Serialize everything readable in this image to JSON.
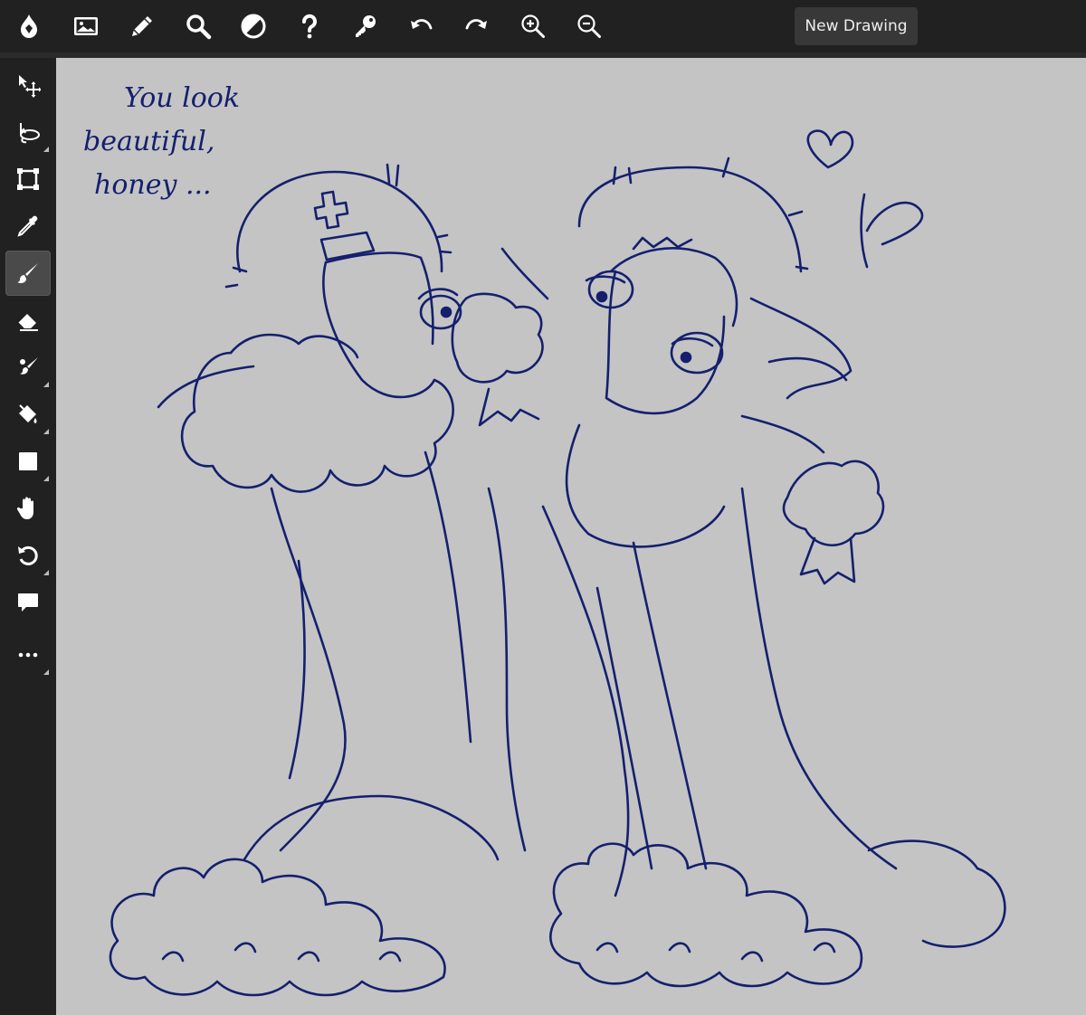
{
  "toolbar": {
    "new_drawing_label": "New Drawing",
    "buttons": [
      {
        "name": "app-logo-icon",
        "icon": "drop-logo"
      },
      {
        "name": "image-icon",
        "icon": "image"
      },
      {
        "name": "pencil-icon",
        "icon": "pencil"
      },
      {
        "name": "search-icon",
        "icon": "magnifier"
      },
      {
        "name": "contrast-icon",
        "icon": "half-circle"
      },
      {
        "name": "help-icon",
        "icon": "question-mark"
      },
      {
        "name": "key-icon",
        "icon": "key"
      },
      {
        "name": "undo-icon",
        "icon": "undo-arrow"
      },
      {
        "name": "redo-icon",
        "icon": "redo-arrow"
      },
      {
        "name": "zoom-in-icon",
        "icon": "magnifier-plus"
      },
      {
        "name": "zoom-out-icon",
        "icon": "magnifier-minus"
      }
    ]
  },
  "sidebar": {
    "tools": [
      {
        "name": "move-tool",
        "icon": "arrow-move"
      },
      {
        "name": "lasso-tool",
        "icon": "lasso"
      },
      {
        "name": "transform-tool",
        "icon": "bounding-box"
      },
      {
        "name": "eyedropper-tool",
        "icon": "eyedropper"
      },
      {
        "name": "brush-tool",
        "icon": "brush",
        "active": true
      },
      {
        "name": "eraser-tool",
        "icon": "eraser"
      },
      {
        "name": "smudge-tool",
        "icon": "brushes"
      },
      {
        "name": "fill-tool",
        "icon": "paint-bucket"
      },
      {
        "name": "shape-tool",
        "icon": "square"
      },
      {
        "name": "hand-tool",
        "icon": "hand"
      },
      {
        "name": "rotate-tool",
        "icon": "rotate-ccw"
      },
      {
        "name": "text-tool",
        "icon": "speech-bubble"
      },
      {
        "name": "more-tools",
        "icon": "ellipsis"
      }
    ]
  },
  "canvas": {
    "background_color": "#c4c4c4",
    "stroke_color": "#14206e",
    "handwriting": [
      "You look",
      "beautiful,",
      "honey ..."
    ]
  }
}
